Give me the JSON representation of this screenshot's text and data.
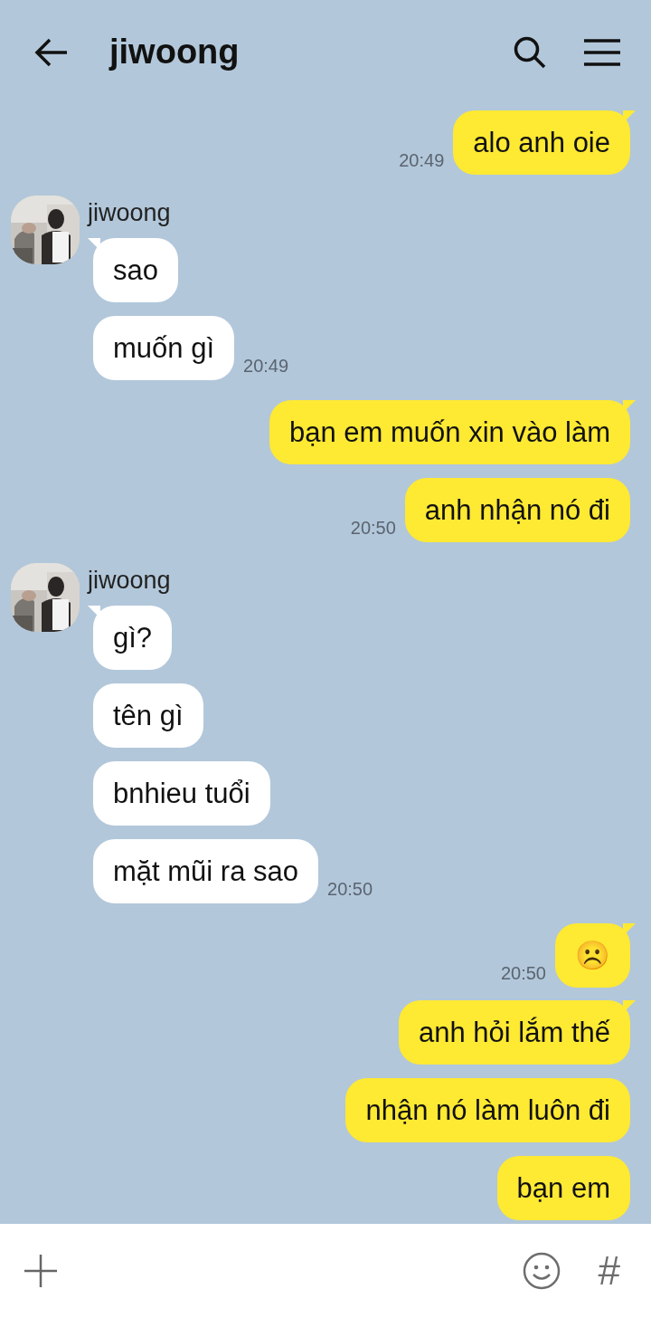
{
  "header": {
    "title": "jiwoong"
  },
  "groups": [
    {
      "kind": "outgoing",
      "bubbles": [
        {
          "text": "alo anh oie",
          "time": "20:49"
        }
      ]
    },
    {
      "kind": "incoming",
      "sender": "jiwoong",
      "bubbles": [
        {
          "text": "sao"
        },
        {
          "text": "muốn gì",
          "time": "20:49"
        }
      ]
    },
    {
      "kind": "outgoing",
      "bubbles": [
        {
          "text": "bạn em muốn xin vào làm"
        },
        {
          "text": "anh nhận nó đi",
          "time": "20:50"
        }
      ]
    },
    {
      "kind": "incoming",
      "sender": "jiwoong",
      "bubbles": [
        {
          "text": "gì?"
        },
        {
          "text": "tên gì"
        },
        {
          "text": "bnhieu tuổi"
        },
        {
          "text": "mặt mũi ra sao",
          "time": "20:50"
        }
      ]
    },
    {
      "kind": "outgoing",
      "bubbles": [
        {
          "text": "☹️",
          "time": "20:50"
        }
      ]
    },
    {
      "kind": "outgoing",
      "bubbles": [
        {
          "text": "anh hỏi lắm thế"
        },
        {
          "text": "nhận nó làm luôn đi"
        },
        {
          "text": "bạn em"
        }
      ]
    }
  ],
  "input_bar": {
    "hash": "#"
  }
}
